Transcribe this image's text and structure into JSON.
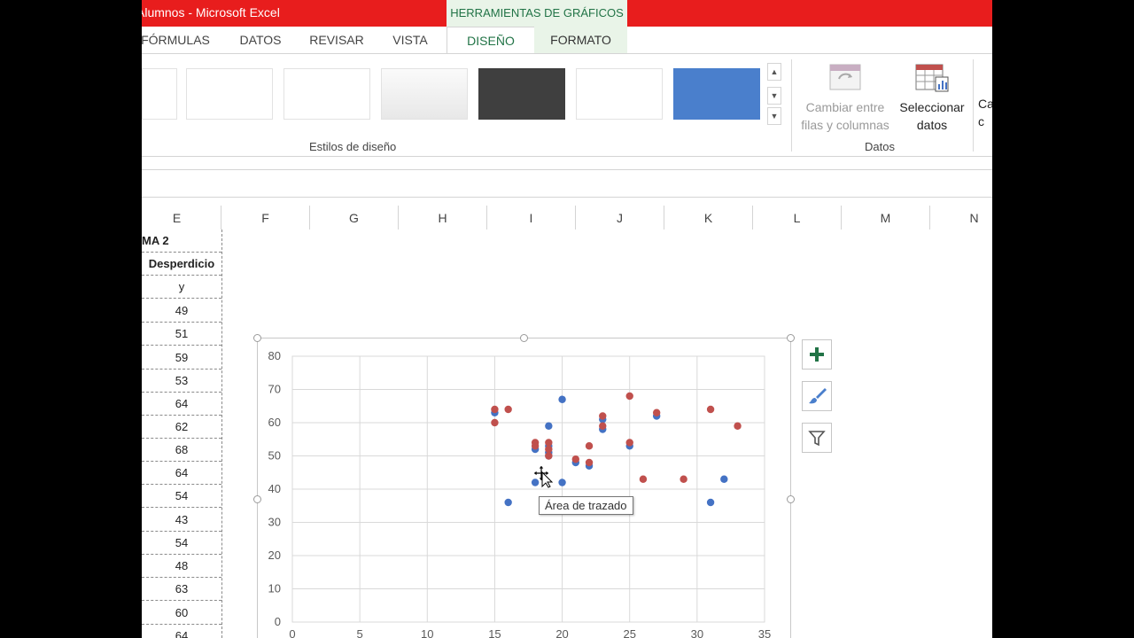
{
  "window": {
    "title": "Alumnos -  Microsoft Excel",
    "tools_tab": "HERRAMIENTAS DE GRÁFICOS"
  },
  "tabs": [
    {
      "label": "FÓRMULAS"
    },
    {
      "label": "DATOS"
    },
    {
      "label": "REVISAR"
    },
    {
      "label": "VISTA"
    },
    {
      "label": "DISEÑO",
      "selected": true
    },
    {
      "label": "FORMATO"
    }
  ],
  "ribbon": {
    "styles_group_label": "Estilos de diseño",
    "data_group_label": "Datos",
    "switch_label_1": "Cambiar entre",
    "switch_label_2": "filas y columnas",
    "select_label_1": "Seleccionar",
    "select_label_2": "datos",
    "next_label_1": "Ca",
    "next_label_2": "c"
  },
  "columns": [
    "E",
    "F",
    "G",
    "H",
    "I",
    "J",
    "K",
    "L",
    "M",
    "N"
  ],
  "column_e_cells": [
    "MA 2",
    "Desperdicio",
    "y",
    "49",
    "51",
    "59",
    "53",
    "64",
    "62",
    "68",
    "64",
    "54",
    "43",
    "54",
    "48",
    "63",
    "60",
    "64"
  ],
  "tooltip": "Área de trazado",
  "colors": {
    "excel_red": "#e81d1d",
    "excel_green": "#217346",
    "series1": "#4472c4",
    "series2": "#c0504d"
  },
  "chart_data": {
    "type": "scatter",
    "ylim": [
      0,
      80
    ],
    "xlim": [
      0,
      35
    ],
    "y_ticks": [
      0,
      10,
      20,
      30,
      40,
      50,
      60,
      70,
      80
    ],
    "x_ticks": [
      0,
      5,
      10,
      15,
      20,
      25,
      30,
      35
    ],
    "grid": true,
    "series": [
      {
        "color": "#4472c4",
        "points": [
          [
            15,
            63
          ],
          [
            16,
            36
          ],
          [
            18,
            52
          ],
          [
            18,
            42
          ],
          [
            19,
            59
          ],
          [
            19,
            53
          ],
          [
            19,
            51
          ],
          [
            19,
            50
          ],
          [
            20,
            67
          ],
          [
            20,
            42
          ],
          [
            21,
            48
          ],
          [
            22,
            47
          ],
          [
            23,
            61
          ],
          [
            23,
            58
          ],
          [
            25,
            53
          ],
          [
            27,
            62
          ],
          [
            31,
            36
          ],
          [
            32,
            43
          ]
        ]
      },
      {
        "color": "#c0504d",
        "points": [
          [
            15,
            64
          ],
          [
            15,
            60
          ],
          [
            16,
            64
          ],
          [
            18,
            54
          ],
          [
            18,
            53
          ],
          [
            19,
            54
          ],
          [
            19,
            52
          ],
          [
            19,
            50
          ],
          [
            21,
            49
          ],
          [
            22,
            48
          ],
          [
            22,
            53
          ],
          [
            23,
            62
          ],
          [
            23,
            59
          ],
          [
            25,
            68
          ],
          [
            25,
            54
          ],
          [
            26,
            43
          ],
          [
            27,
            63
          ],
          [
            29,
            43
          ],
          [
            31,
            64
          ],
          [
            33,
            59
          ]
        ]
      }
    ]
  }
}
